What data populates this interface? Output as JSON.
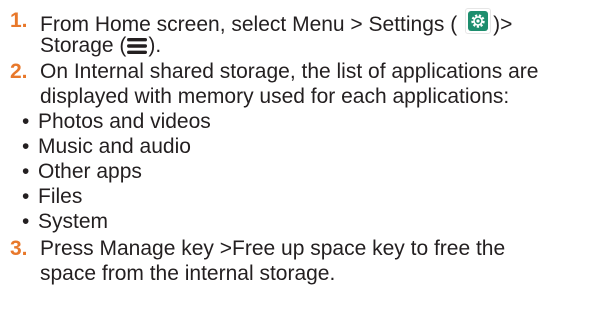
{
  "steps": [
    {
      "number": "1.",
      "line1_text": "From Home screen, select Menu  > Settings  (",
      "line1_after_icon": ")>",
      "line2_text": "Storage (",
      "line2_after_icon": ")."
    },
    {
      "number": "2.",
      "line1": "On Internal shared storage, the list of applications are",
      "line2": "displayed with memory used for each applications:"
    },
    {
      "number": "3.",
      "line1": "Press Manage key >Free up space key to free the",
      "line2": "space from the internal storage."
    }
  ],
  "bullet_char": "•",
  "bullets": [
    "Photos and videos",
    "Music and audio",
    "Other apps",
    "Files",
    "System"
  ],
  "icons": {
    "settings": "settings-gear-icon",
    "menu": "hamburger-menu-icon"
  },
  "colors": {
    "step_number": "#e8782b",
    "settings_icon_bg": "#1e8e6e",
    "text": "#231f20"
  }
}
